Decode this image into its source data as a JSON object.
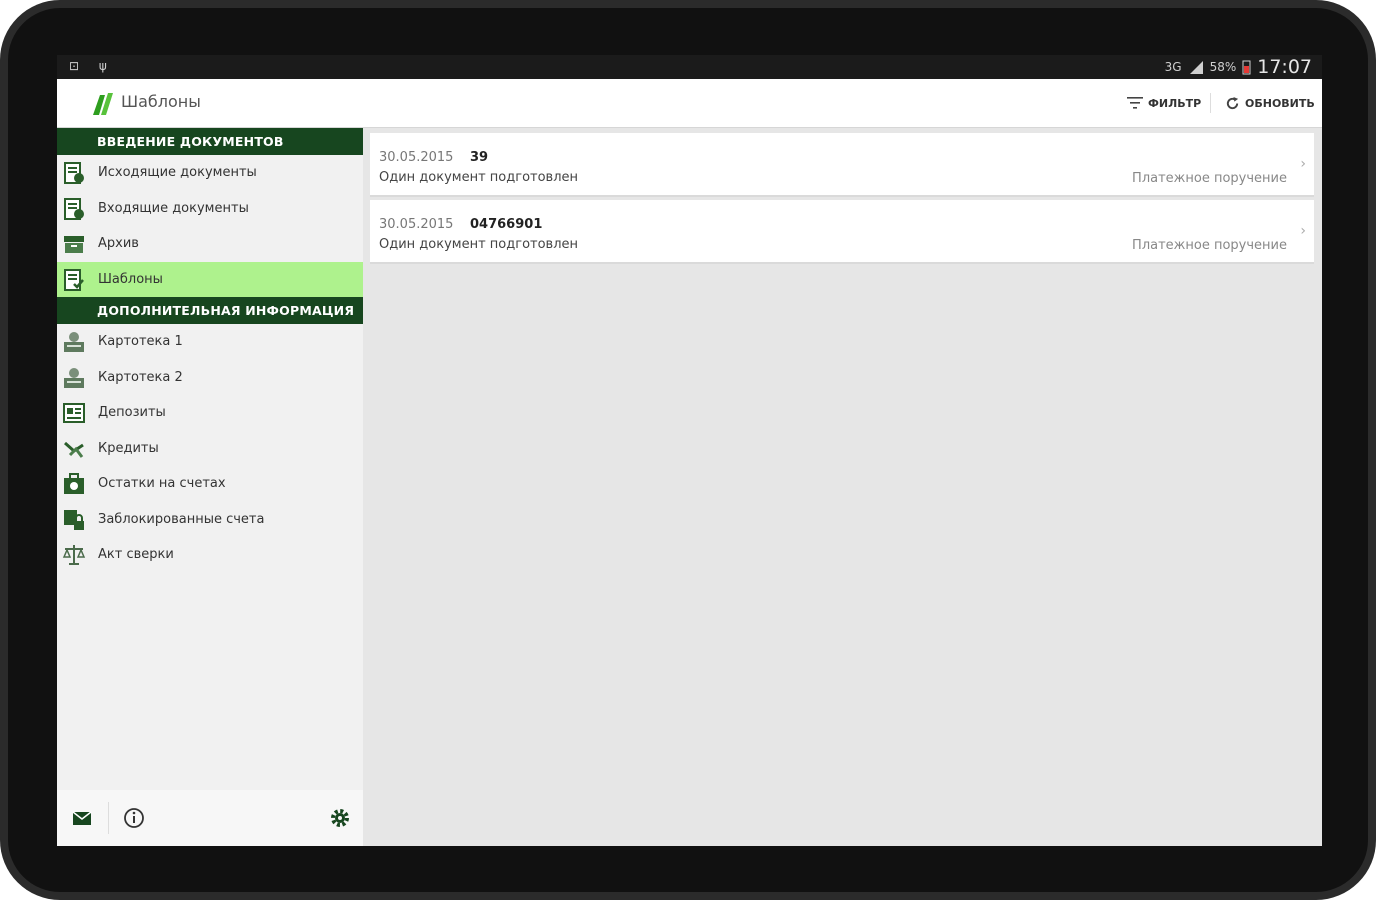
{
  "statusbar": {
    "left_icons": "⊡ ψ",
    "network": "3G",
    "battery": "58%",
    "time": "17:07"
  },
  "appbar": {
    "title": "Шаблоны",
    "filter_label": "ФИЛЬТР",
    "refresh_label": "ОБНОВИТЬ"
  },
  "sidebar": {
    "section1": "ВВЕДЕНИЕ ДОКУМЕНТОВ",
    "items1": [
      {
        "label": "Исходящие документы",
        "icon": "outgoing-docs-icon"
      },
      {
        "label": "Входящие документы",
        "icon": "incoming-docs-icon"
      },
      {
        "label": "Архив",
        "icon": "archive-icon"
      },
      {
        "label": "Шаблоны",
        "icon": "templates-icon"
      }
    ],
    "section2": "ДОПОЛНИТЕЛЬНАЯ ИНФОРМАЦИЯ",
    "items2": [
      {
        "label": "Картотека 1",
        "icon": "card-index-icon"
      },
      {
        "label": "Картотека 2",
        "icon": "card-index-icon"
      },
      {
        "label": "Депозиты",
        "icon": "deposits-icon"
      },
      {
        "label": "Кредиты",
        "icon": "credits-icon"
      },
      {
        "label": "Остатки на счетах",
        "icon": "balance-icon"
      },
      {
        "label": "Заблокированные счета",
        "icon": "locked-accounts-icon"
      },
      {
        "label": "Акт сверки",
        "icon": "scales-icon"
      }
    ]
  },
  "templates": [
    {
      "date": "30.05.2015",
      "number": "39",
      "status": "Один документ подготовлен",
      "type": "Платежное поручение"
    },
    {
      "date": "30.05.2015",
      "number": "04766901",
      "status": "Один документ подготовлен",
      "type": "Платежное поручение"
    }
  ],
  "colors": {
    "section_header": "#17461f",
    "active_item": "#aef28d",
    "brand_green": "#2e9e1f"
  }
}
